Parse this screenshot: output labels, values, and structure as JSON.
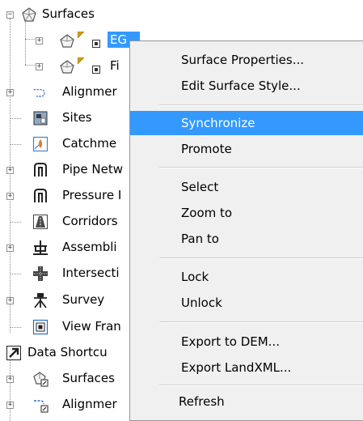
{
  "tree": {
    "surfaces": "Surfaces",
    "eg": "EG",
    "fi": "Fi",
    "alignments": "Alignmer",
    "sites": "Sites",
    "catchments": "Catchme",
    "pipe_networks": "Pipe Netw",
    "pressure": "Pressure I",
    "corridors": "Corridors",
    "assemblies": "Assembli",
    "intersections": "Intersecti",
    "survey": "Survey",
    "view_frames": "View Fran",
    "data_shortcuts": "Data Shortcu",
    "ds_surfaces": "Surfaces",
    "ds_alignments": "Alignmer"
  },
  "menu": {
    "surface_properties": "Surface Properties...",
    "edit_surface_style": "Edit Surface Style...",
    "synchronize": "Synchronize",
    "promote": "Promote",
    "select": "Select",
    "zoom_to": "Zoom to",
    "pan_to": "Pan to",
    "lock": "Lock",
    "unlock": "Unlock",
    "export_dem": "Export to DEM...",
    "export_landxml": "Export LandXML...",
    "refresh": "Refresh"
  },
  "colors": {
    "highlight": "#3399ff",
    "menu_bg": "#f0f0f0"
  }
}
